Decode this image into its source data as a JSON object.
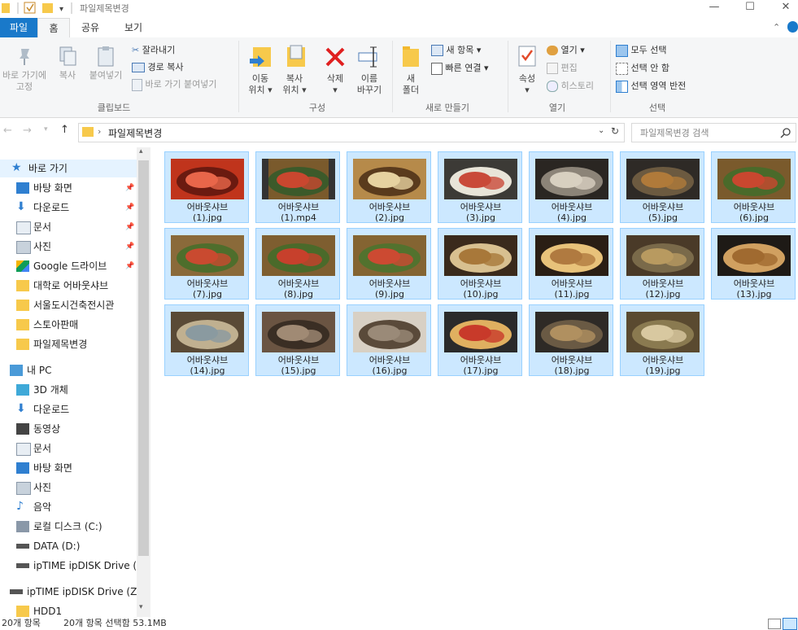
{
  "window": {
    "title": "파일제목변경",
    "minimize": "—",
    "maximize": "☐",
    "close": "✕"
  },
  "ribbon_tabs": [
    "파일",
    "홈",
    "공유",
    "보기"
  ],
  "ribbon": {
    "clipboard": {
      "pin_label_1": "바로 가기에",
      "pin_label_2": "고정",
      "copy": "복사",
      "paste": "붙여넣기",
      "cut": "잘라내기",
      "copy_path": "경로 복사",
      "paste_shortcut": "바로 가기 붙여넣기",
      "group": "클립보드"
    },
    "organize": {
      "move_1": "이동",
      "move_2": "위치 ▾",
      "copy_1": "복사",
      "copy_2": "위치 ▾",
      "delete_1": "삭제",
      "delete_2": "▾",
      "rename_1": "이름",
      "rename_2": "바꾸기",
      "group": "구성"
    },
    "new": {
      "folder_1": "새",
      "folder_2": "폴더",
      "new_item": "새 항목 ▾",
      "easy_access": "빠른 연결 ▾",
      "group": "새로 만들기"
    },
    "open": {
      "properties": "속성",
      "properties_arrow": "▾",
      "open": "열기 ▾",
      "edit": "편집",
      "history": "히스토리",
      "group": "열기"
    },
    "select": {
      "select_all": "모두 선택",
      "select_none": "선택 안 함",
      "invert": "선택 영역 반전",
      "group": "선택"
    }
  },
  "address": {
    "path": "파일제목변경",
    "search_placeholder": "파일제목변경 검색"
  },
  "nav": {
    "quick_access": "바로 가기",
    "items": [
      {
        "label": "바탕 화면",
        "icon": "desktop-icon",
        "pinned": true
      },
      {
        "label": "다운로드",
        "icon": "download-icon",
        "pinned": true
      },
      {
        "label": "문서",
        "icon": "document-icon",
        "pinned": true
      },
      {
        "label": "사진",
        "icon": "pictures-icon",
        "pinned": true
      },
      {
        "label": "Google 드라이브",
        "icon": "google-drive-icon",
        "pinned": true
      },
      {
        "label": "대학로 어바웃샤브",
        "icon": "folder-icon",
        "pinned": false
      },
      {
        "label": "서울도시건축전시관",
        "icon": "folder-icon",
        "pinned": false
      },
      {
        "label": "스토아판매",
        "icon": "folder-icon",
        "pinned": false
      },
      {
        "label": "파일제목변경",
        "icon": "folder-icon",
        "pinned": false
      }
    ],
    "this_pc": "내 PC",
    "pc_items": [
      {
        "label": "3D 개체",
        "icon": "3d-objects-icon"
      },
      {
        "label": "다운로드",
        "icon": "download-icon"
      },
      {
        "label": "동영상",
        "icon": "video-icon"
      },
      {
        "label": "문서",
        "icon": "document-icon"
      },
      {
        "label": "바탕 화면",
        "icon": "desktop-icon"
      },
      {
        "label": "사진",
        "icon": "pictures-icon"
      },
      {
        "label": "음악",
        "icon": "music-icon"
      },
      {
        "label": "로컬 디스크 (C:)",
        "icon": "local-disk-icon"
      },
      {
        "label": "DATA (D:)",
        "icon": "drive-icon"
      },
      {
        "label": "ipTIME ipDISK Drive (Z:",
        "icon": "network-drive-icon"
      }
    ],
    "network_drive": "ipTIME ipDISK Drive (Z:)",
    "hdd": "HDD1"
  },
  "files": [
    {
      "line1": "어바웃샤브",
      "line2": "(1).jpg",
      "palette": [
        "#c0341c",
        "#e8664a",
        "#6b1a10"
      ]
    },
    {
      "line1": "어바웃샤브",
      "line2": "(1).mp4",
      "palette": [
        "#7a5a2c",
        "#c9472f",
        "#3c5a2a"
      ]
    },
    {
      "line1": "어바웃샤브",
      "line2": "(2).jpg",
      "palette": [
        "#b68a4a",
        "#e6d2a0",
        "#5a3b1d"
      ]
    },
    {
      "line1": "어바웃샤브",
      "line2": "(3).jpg",
      "palette": [
        "#3c3a36",
        "#c94a3a",
        "#e8e4d8"
      ]
    },
    {
      "line1": "어바웃샤브",
      "line2": "(4).jpg",
      "palette": [
        "#2a2622",
        "#d8d0c0",
        "#8c8478"
      ]
    },
    {
      "line1": "어바웃샤브",
      "line2": "(5).jpg",
      "palette": [
        "#2e2a26",
        "#b07a3a",
        "#6c5a40"
      ]
    },
    {
      "line1": "어바웃샤브",
      "line2": "(6).jpg",
      "palette": [
        "#7a5a2c",
        "#c9472f",
        "#4a6a2a"
      ]
    },
    {
      "line1": "어바웃샤브",
      "line2": "(7).jpg",
      "palette": [
        "#8a6a3a",
        "#c94a30",
        "#4e6e2c"
      ]
    },
    {
      "line1": "어바웃샤브",
      "line2": "(8).jpg",
      "palette": [
        "#7e5e30",
        "#c7402c",
        "#4a6a2a"
      ]
    },
    {
      "line1": "어바웃샤브",
      "line2": "(9).jpg",
      "palette": [
        "#846432",
        "#cc4a32",
        "#52722e"
      ]
    },
    {
      "line1": "어바웃샤브",
      "line2": "(10).jpg",
      "palette": [
        "#3a2a1c",
        "#a8783a",
        "#d8c090"
      ]
    },
    {
      "line1": "어바웃샤브",
      "line2": "(11).jpg",
      "palette": [
        "#2a1e14",
        "#b07a40",
        "#e8c27a"
      ]
    },
    {
      "line1": "어바웃샤브",
      "line2": "(12).jpg",
      "palette": [
        "#4a3a28",
        "#b89a60",
        "#7a6a4a"
      ]
    },
    {
      "line1": "어바웃샤브",
      "line2": "(13).jpg",
      "palette": [
        "#1e1a16",
        "#a06a30",
        "#d0a060"
      ]
    },
    {
      "line1": "어바웃샤브",
      "line2": "(14).jpg",
      "palette": [
        "#5a4a36",
        "#8a9aa0",
        "#c0b090"
      ]
    },
    {
      "line1": "어바웃샤브",
      "line2": "(15).jpg",
      "palette": [
        "#6a5442",
        "#a08a74",
        "#3a2e24"
      ]
    },
    {
      "line1": "어바웃샤브",
      "line2": "(16).jpg",
      "palette": [
        "#d8d0c4",
        "#9a8a78",
        "#5a4a3a"
      ]
    },
    {
      "line1": "어바웃샤브",
      "line2": "(17).jpg",
      "palette": [
        "#2a2a2a",
        "#c83a2a",
        "#e0b060"
      ]
    },
    {
      "line1": "어바웃샤브",
      "line2": "(18).jpg",
      "palette": [
        "#2e2a26",
        "#b09060",
        "#6a5a44"
      ]
    },
    {
      "line1": "어바웃샤브",
      "line2": "(19).jpg",
      "palette": [
        "#5a4a30",
        "#d8c8a0",
        "#8a7a50"
      ]
    }
  ],
  "status": {
    "count": "20개 항목",
    "selected": "20개 항목 선택함 53.1MB"
  },
  "colors": {
    "accent": "#1979ca",
    "selection": "#cce8ff",
    "selection_border": "#99d1ff",
    "folder": "#f7c94b"
  }
}
